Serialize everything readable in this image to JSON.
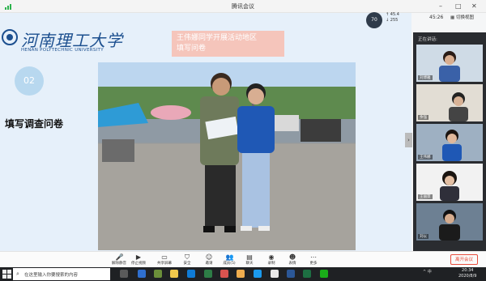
{
  "window": {
    "title": "腾讯会议"
  },
  "network": {
    "latency": "70",
    "unit": "ms",
    "up": "45.4",
    "down": "255"
  },
  "clock_top": "45:26",
  "switch_view": "切换视图",
  "slide": {
    "logo_cn": "河南理工大学",
    "logo_en": "HENAN POLYTECHNIC UNIVERSITY",
    "number": "02",
    "section_title": "填写调查问卷",
    "caption_line1": "王伟娜同学开展活动地区",
    "caption_line2": "填写问卷"
  },
  "panel": {
    "header": "正在讲话:",
    "participants": [
      {
        "name": "刘博雅"
      },
      {
        "name": "余强"
      },
      {
        "name": "王伟娜"
      },
      {
        "name": "王丽萍"
      },
      {
        "name": "刘以"
      }
    ]
  },
  "toolbar": {
    "items": [
      {
        "label": "解除静音",
        "icon": "microphone-icon"
      },
      {
        "label": "停止视频",
        "icon": "camera-icon"
      },
      {
        "label": "共享屏幕",
        "icon": "share-screen-icon"
      },
      {
        "label": "安全",
        "icon": "shield-icon"
      },
      {
        "label": "邀请",
        "icon": "invite-icon"
      },
      {
        "label": "成员(5)",
        "icon": "members-icon"
      },
      {
        "label": "聊天",
        "icon": "chat-icon"
      },
      {
        "label": "录制",
        "icon": "record-icon"
      },
      {
        "label": "表情",
        "icon": "emoji-icon"
      },
      {
        "label": "更多",
        "icon": "more-icon"
      }
    ],
    "leave": "离开会议"
  },
  "taskbar": {
    "search_placeholder": "在这里输入你要搜索的内容",
    "time": "20:34",
    "date": "2020/8/9",
    "tray": "^ 中"
  }
}
